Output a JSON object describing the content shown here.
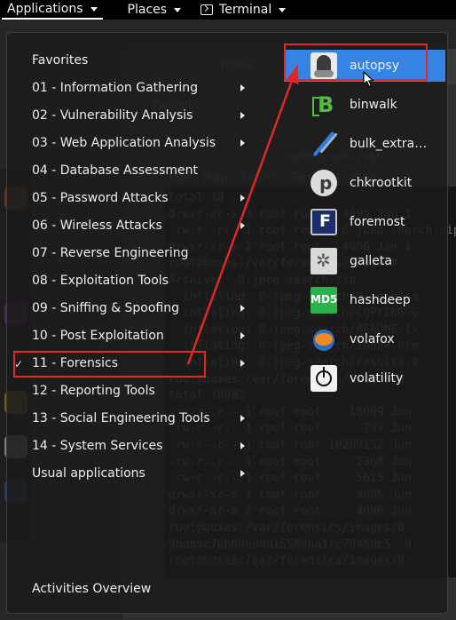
{
  "topbar": {
    "applications_label": "Applications",
    "places_label": "Places",
    "terminal_label": "Terminal"
  },
  "background": {
    "window_lines": [
      "Home",
      "Recent",
      "Edit   View   Search   Terminal   Help",
      "root@boxes: /var/",
      "total 19",
      "drwxr-xr-x 3 root root   4096 Jan 1",
      "-rw-r--r-- 1 root root   8-jpeg-search.zip",
      "drwxr-xr-x 2 root root   4096 Jan 1",
      "root@boxes:/var/forensics/images#",
      "Archive:  8-jpeg-search.zip",
      "  inflating: 8-jpeg-search/8-jpeg-se",
      "  inflating: 8-jpeg-search/COPYING-G",
      "  inflating: 8-jpeg-search/README.tx",
      "  inflating: 8-jpeg-search/index.htm",
      "  inflating: 8-jpeg-search/results.t",
      "root@boxes:/var/forensics/images/8",
      "total 18092",
      "-rw-r--r-- 1 root root    18009 Jun",
      "-rw-r--r-- 1 root root      799 Jun",
      "-rw-r--r-- 1 root root 10289152 Jun",
      "-rw-r--r-- 1 root root     2368 Jun",
      "-rw-r--r-- 1 root root     5615 Jun",
      "drwxr-xr-x 3 root root     4096 Jun",
      "drwxr-xr-x 2 root root     4096 Jun",
      "root@boxes:/var/forensics/images/8",
      "9bdb9c76b80e90d155806a1fc7846db5  8-",
      "root@boxes:/var/forensics/images/8"
    ]
  },
  "menu": {
    "categories": [
      {
        "label": "Favorites",
        "has_submenu": false
      },
      {
        "label": "01 - Information Gathering",
        "has_submenu": true
      },
      {
        "label": "02 - Vulnerability Analysis",
        "has_submenu": true
      },
      {
        "label": "03 - Web Application Analysis",
        "has_submenu": true
      },
      {
        "label": "04 - Database Assessment",
        "has_submenu": false
      },
      {
        "label": "05 - Password Attacks",
        "has_submenu": true
      },
      {
        "label": "06 - Wireless Attacks",
        "has_submenu": true
      },
      {
        "label": "07 - Reverse Engineering",
        "has_submenu": false
      },
      {
        "label": "08 - Exploitation Tools",
        "has_submenu": false
      },
      {
        "label": "09 - Sniffing & Spoofing",
        "has_submenu": true
      },
      {
        "label": "10 - Post Exploitation",
        "has_submenu": true
      },
      {
        "label": "11 - Forensics",
        "has_submenu": true,
        "selected": true
      },
      {
        "label": "12 - Reporting Tools",
        "has_submenu": false
      },
      {
        "label": "13 - Social Engineering Tools",
        "has_submenu": true
      },
      {
        "label": "14 - System Services",
        "has_submenu": true
      },
      {
        "label": "Usual applications",
        "has_submenu": true
      }
    ],
    "activities_label": "Activities Overview",
    "selected_check": "✓",
    "apps": [
      {
        "label": "autopsy",
        "icon": "autopsy-icon",
        "active": true
      },
      {
        "label": "binwalk",
        "icon": "binwalk-icon"
      },
      {
        "label": "bulk_extra…",
        "icon": "bulk-extractor-icon"
      },
      {
        "label": "chkrootkit",
        "icon": "chkrootkit-icon"
      },
      {
        "label": "foremost",
        "icon": "foremost-icon"
      },
      {
        "label": "galleta",
        "icon": "galleta-icon"
      },
      {
        "label": "hashdeep",
        "icon": "hashdeep-icon"
      },
      {
        "label": "volafox",
        "icon": "volafox-icon"
      },
      {
        "label": "volatility",
        "icon": "volatility-icon"
      }
    ],
    "app_glyphs": {
      "binwalk": "B",
      "chkrootkit": "p",
      "foremost": "F",
      "galleta": "✲",
      "hashdeep": "MD5"
    }
  },
  "colors": {
    "selection_blue": "#3584e4",
    "annotation_red": "#e02828"
  }
}
